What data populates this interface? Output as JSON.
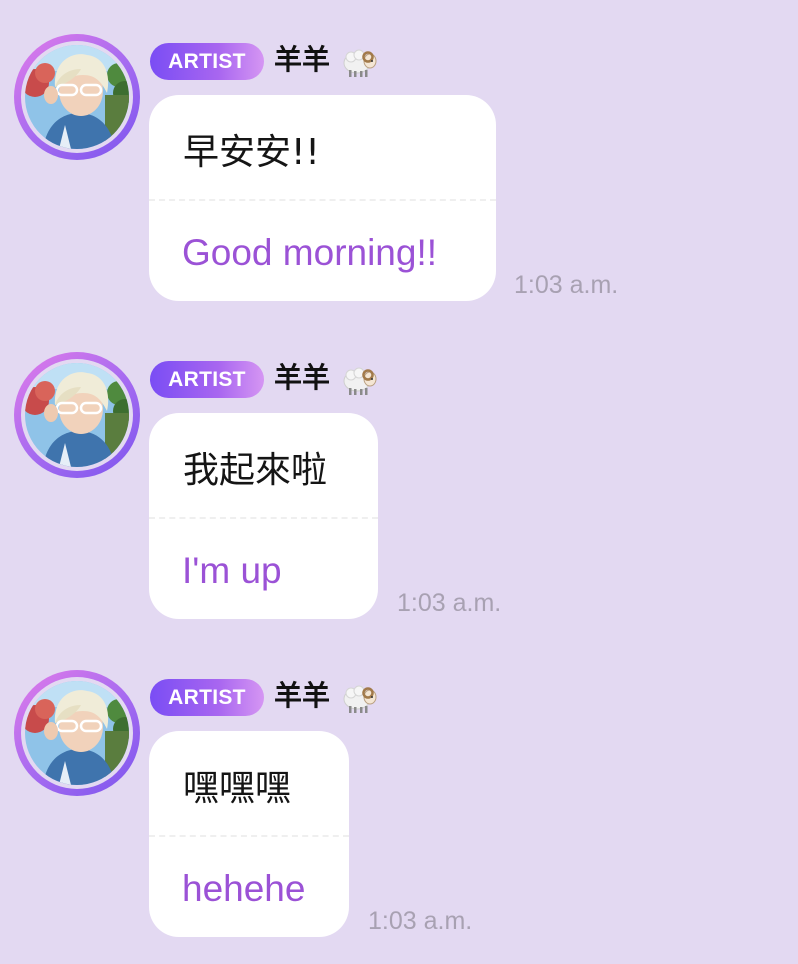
{
  "colors": {
    "background": "#e3d9f2",
    "bubble": "#ffffff",
    "translation_text": "#9b52d6",
    "badge_gradient_start": "#7a4df4",
    "badge_gradient_end": "#d596f3",
    "timestamp": "#a8a1b2"
  },
  "sender": {
    "badge": "ARTIST",
    "name": "羊羊",
    "name_emoji_icon": "sheep-icon",
    "avatar_icon": "profile-photo"
  },
  "messages": [
    {
      "original": "早安安!!",
      "translation": "Good morning!!",
      "time": "1:03 a.m."
    },
    {
      "original": "我起來啦",
      "translation": "I'm up",
      "time": "1:03 a.m."
    },
    {
      "original": "嘿嘿嘿",
      "translation": "hehehe",
      "time": "1:03 a.m."
    }
  ]
}
